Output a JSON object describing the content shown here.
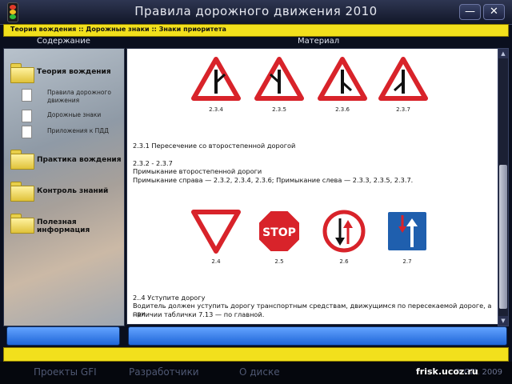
{
  "window": {
    "title": "Правила дорожного движения 2010",
    "minimize_label": "—",
    "close_label": "✕"
  },
  "breadcrumb": "Теория вождения :: Дорожные знаки :: Знаки приоритета",
  "columns": {
    "sidebar_header": "Содержание",
    "content_header": "Материал"
  },
  "sidebar": {
    "sections": [
      {
        "label": "Теория вождения",
        "items": [
          "Правила дорожного движения",
          "Дорожные знаки",
          "Приложения к ПДД"
        ]
      },
      {
        "label": "Практика вождения"
      },
      {
        "label": "Контроль знаний"
      },
      {
        "label": "Полезная информация"
      }
    ]
  },
  "content": {
    "signs_row1": [
      "2.3.4",
      "2.3.5",
      "2.3.6",
      "2.3.7"
    ],
    "para1": "2.3.1 Пересечение со второстепенной дорогой",
    "para2_line1": "2.3.2 - 2.3.7",
    "para2_line2": "Примыкание второстепенной дороги",
    "para2_line3": "Примыкание справа — 2.3.2, 2.3.4, 2.3.6; Примыкание слева — 2.3.3, 2.3.5, 2.3.7.",
    "signs_row2": [
      "2.4",
      "2.5",
      "2.6",
      "2.7"
    ],
    "stop_text": "STOP",
    "para3_line1": "2..4 Уступите дорогу",
    "para3_line2": "Водитель должен уступить дорогу транспортным средствам, движущимся по пересекаемой дороге, а при",
    "para3_line3": "наличии таблички 7.13 — по главной."
  },
  "footer": {
    "links": [
      "Проекты GFI",
      "Разработчики",
      "О диске"
    ],
    "copyright": "© GFI, 2009"
  },
  "watermark": "frisk.ucoz.ru",
  "colors": {
    "accent_yellow": "#f2e01c",
    "sign_red": "#d8232a",
    "sign_blue": "#1f5fae",
    "bar_blue": "#2f7cf0"
  }
}
